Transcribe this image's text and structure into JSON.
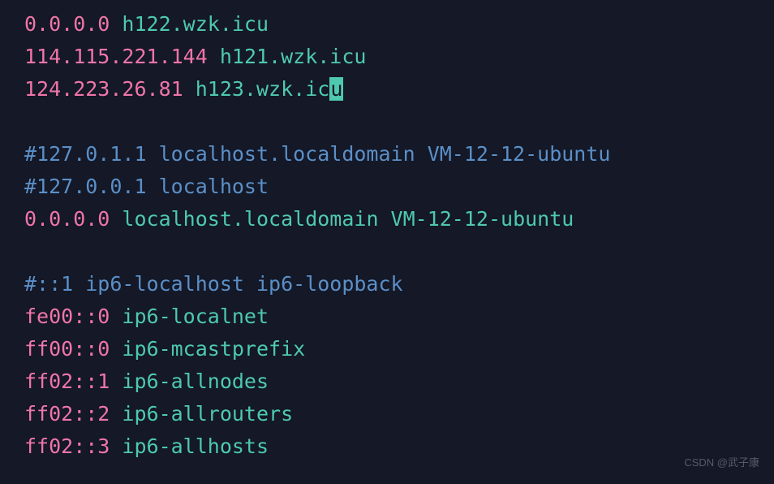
{
  "lines": [
    {
      "type": "entry",
      "ip": "0.0.0.0",
      "host": "h122.wzk.icu"
    },
    {
      "type": "entry",
      "ip": "114.115.221.144",
      "host": "h121.wzk.icu"
    },
    {
      "type": "entry_cursor",
      "ip": "124.223.26.81",
      "host_pre": "h123.wzk.ic",
      "cursor_char": "u"
    },
    {
      "type": "blank"
    },
    {
      "type": "comment",
      "text": "#127.0.1.1 localhost.localdomain VM-12-12-ubuntu"
    },
    {
      "type": "comment",
      "text": "#127.0.0.1 localhost"
    },
    {
      "type": "entry",
      "ip": "0.0.0.0",
      "host": "localhost.localdomain VM-12-12-ubuntu"
    },
    {
      "type": "blank"
    },
    {
      "type": "comment",
      "text": "#::1 ip6-localhost ip6-loopback"
    },
    {
      "type": "entry",
      "ip": "fe00::0",
      "host": "ip6-localnet"
    },
    {
      "type": "entry",
      "ip": "ff00::0",
      "host": "ip6-mcastprefix"
    },
    {
      "type": "entry",
      "ip": "ff02::1",
      "host": "ip6-allnodes"
    },
    {
      "type": "entry",
      "ip": "ff02::2",
      "host": "ip6-allrouters"
    },
    {
      "type": "entry",
      "ip": "ff02::3",
      "host": "ip6-allhosts"
    }
  ],
  "watermark": "CSDN @武子康"
}
